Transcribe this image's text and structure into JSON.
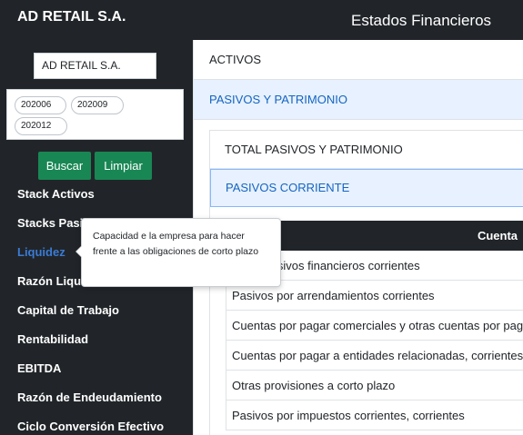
{
  "header": {
    "brand": "AD RETAIL S.A.",
    "title": "Estados Financieros"
  },
  "sidebar": {
    "company_value": "AD RETAIL S.A.",
    "periods": [
      "202006",
      "202009",
      "202012"
    ],
    "buttons": {
      "search": "Buscar",
      "clear": "Limpiar"
    },
    "items": [
      {
        "label": "Stack Activos"
      },
      {
        "label": "Stacks Pasivos"
      },
      {
        "label": "Liquidez",
        "active": true
      },
      {
        "label": "Razón Liquidez"
      },
      {
        "label": "Capital de Trabajo"
      },
      {
        "label": "Rentabilidad"
      },
      {
        "label": "EBITDA"
      },
      {
        "label": "Razón de Endeudamiento"
      },
      {
        "label": "Ciclo Conversión Efectivo"
      }
    ]
  },
  "tooltip": {
    "text": "Capacidad e la empresa para hacer frente a las obligaciones de corto plazo"
  },
  "main": {
    "sections": {
      "activos": "ACTIVOS",
      "pasivos": "PASIVOS Y PATRIMONIO"
    },
    "subsections": {
      "total": "TOTAL PASIVOS Y PATRIMONIO",
      "corriente": "PASIVOS CORRIENTE"
    },
    "table": {
      "column_header": "Cuenta",
      "rows": [
        "Otros pasivos financieros corrientes",
        "Pasivos por arrendamientos corrientes",
        "Cuentas por pagar comerciales y otras cuentas por pagar",
        "Cuentas por pagar a entidades relacionadas, corrientes",
        "Otras provisiones a corto plazo",
        "Pasivos por impuestos corrientes, corrientes"
      ]
    }
  },
  "colors": {
    "sidebar_bg": "#212529",
    "button_green": "#198754",
    "active_link": "#3a7bd5",
    "accordion_active_bg": "#e7f1ff",
    "accordion_active_text": "#1565c0"
  }
}
